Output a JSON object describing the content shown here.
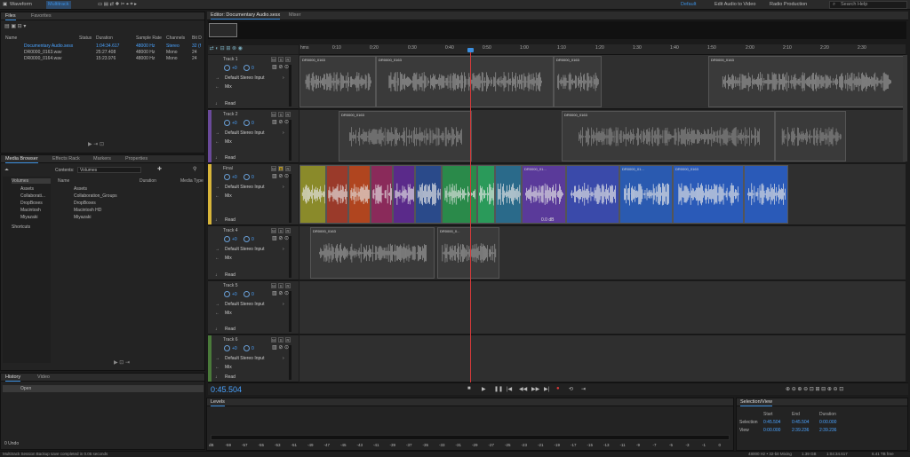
{
  "topbar": {
    "views": [
      "Waveform",
      "Multitrack"
    ],
    "workspaces": [
      "Default",
      "Edit Audio to Video",
      "Radio Production"
    ],
    "search_placeholder": "Search Help"
  },
  "files_panel": {
    "tabs": [
      "Files",
      "Favorites"
    ],
    "columns": [
      "Name",
      "Status",
      "Duration",
      "Sample Rate",
      "Channels",
      "Bit D"
    ],
    "rows": [
      {
        "name": "Documentary Audio.sesx",
        "status": "",
        "duration": "1:04:34.617",
        "rate": "48000 Hz",
        "channels": "Stereo",
        "bits": "32 (f"
      },
      {
        "name": "DR0000_0163.wav",
        "status": "",
        "duration": "25:27.408",
        "rate": "48000 Hz",
        "channels": "Mono",
        "bits": "24"
      },
      {
        "name": "DR0000_0164.wav",
        "status": "",
        "duration": "15:23.976",
        "rate": "48000 Hz",
        "channels": "Mono",
        "bits": "24"
      }
    ]
  },
  "media_panel": {
    "tabs": [
      "Media Browser",
      "Effects Rack",
      "Markers",
      "Properties"
    ],
    "contents_label": "Contents:",
    "contents_value": "Volumes",
    "tree": [
      "Volumes",
      "Assets",
      "Collaborati...",
      "DropBoxes",
      "Macintosh",
      "Miyazaki",
      "Shortcuts"
    ],
    "columns": [
      "Name",
      "Duration",
      "Media Type"
    ],
    "items": [
      "Assets",
      "Collaboration_Groups",
      "DropBoxes",
      "Macintosh HD",
      "Miyazaki"
    ]
  },
  "history_panel": {
    "tabs": [
      "History",
      "Video"
    ],
    "items": [
      "Open"
    ],
    "undo_count": "0 Undo"
  },
  "editor": {
    "tabs": [
      "Editor: Documentary Audio.sesx",
      "Mixer"
    ],
    "ruler_labels": [
      "hms",
      "0:10",
      "0:20",
      "0:30",
      "0:40",
      "0:50",
      "1:00",
      "1:10",
      "1:20",
      "1:30",
      "1:40",
      "1:50",
      "2:00",
      "2:10",
      "2:20",
      "2:30"
    ],
    "time_display": "0:45.504",
    "tracks": [
      {
        "name": "Track 1",
        "volume": "+0",
        "pan": "0",
        "input": "Default Stereo Input",
        "output": "Mix",
        "automation": "Read"
      },
      {
        "name": "Track 2",
        "volume": "+0",
        "pan": "0",
        "input": "Default Stereo Input",
        "output": "Mix",
        "automation": "Read"
      },
      {
        "name": "Final",
        "volume": "+0",
        "pan": "0",
        "input": "Default Stereo Input",
        "output": "Mix",
        "automation": "Read"
      },
      {
        "name": "Track 4",
        "volume": "+0",
        "pan": "0",
        "input": "Default Stereo Input",
        "output": "Mix",
        "automation": "Read"
      },
      {
        "name": "Track 5",
        "volume": "+0",
        "pan": "0",
        "input": "Default Stereo Input",
        "output": "Mix",
        "automation": "Read"
      },
      {
        "name": "Track 6",
        "volume": "+0",
        "pan": "0",
        "input": "Default Stereo Input",
        "output": "Mix",
        "automation": "Read"
      }
    ],
    "clip_labels": {
      "t1": [
        "DR0000_0163",
        "DR0000_0163",
        "DR0000_0163",
        "DR0000_0163"
      ],
      "t2": [
        "DR0000_0163",
        "DR0000_0163"
      ],
      "t3": [
        "DR0000_01...",
        "DR0000_01...",
        "DR0000_0163"
      ],
      "t4": [
        "DR0000_0163",
        "DR0000_0..."
      ]
    },
    "clip_gain": "0.0 dB",
    "msr": [
      "M",
      "S",
      "R"
    ]
  },
  "levels_panel": {
    "title": "Levels",
    "scale": [
      "dB",
      "-59",
      "-57",
      "-55",
      "-53",
      "-51",
      "-49",
      "-47",
      "-45",
      "-43",
      "-41",
      "-39",
      "-37",
      "-35",
      "-33",
      "-31",
      "-29",
      "-27",
      "-25",
      "-23",
      "-21",
      "-19",
      "-17",
      "-15",
      "-13",
      "-11",
      "-9",
      "-7",
      "-5",
      "-3",
      "-1",
      "0"
    ]
  },
  "selection_view": {
    "title": "Selection/View",
    "headers": [
      "Start",
      "End",
      "Duration"
    ],
    "selection": {
      "label": "Selection",
      "start": "0:45.504",
      "end": "0:45.504",
      "duration": "0:00.000"
    },
    "view": {
      "label": "View",
      "start": "0:00.000",
      "end": "2:39.236",
      "duration": "2:39.236"
    }
  },
  "status_bar": {
    "message": "Multitrack Session Backup save completed in 0.05 seconds",
    "format": "48000 Hz • 32-bit Mixing",
    "memory": "1.39 GB",
    "duration": "1:04:34.617",
    "free": "6.41 TB free"
  },
  "colors": {
    "accent": "#3b8fe0",
    "playhead": "#d23a3a",
    "track2": "#6a4a9a",
    "final": "#d8b53a",
    "track6": "#4a7a3a"
  }
}
